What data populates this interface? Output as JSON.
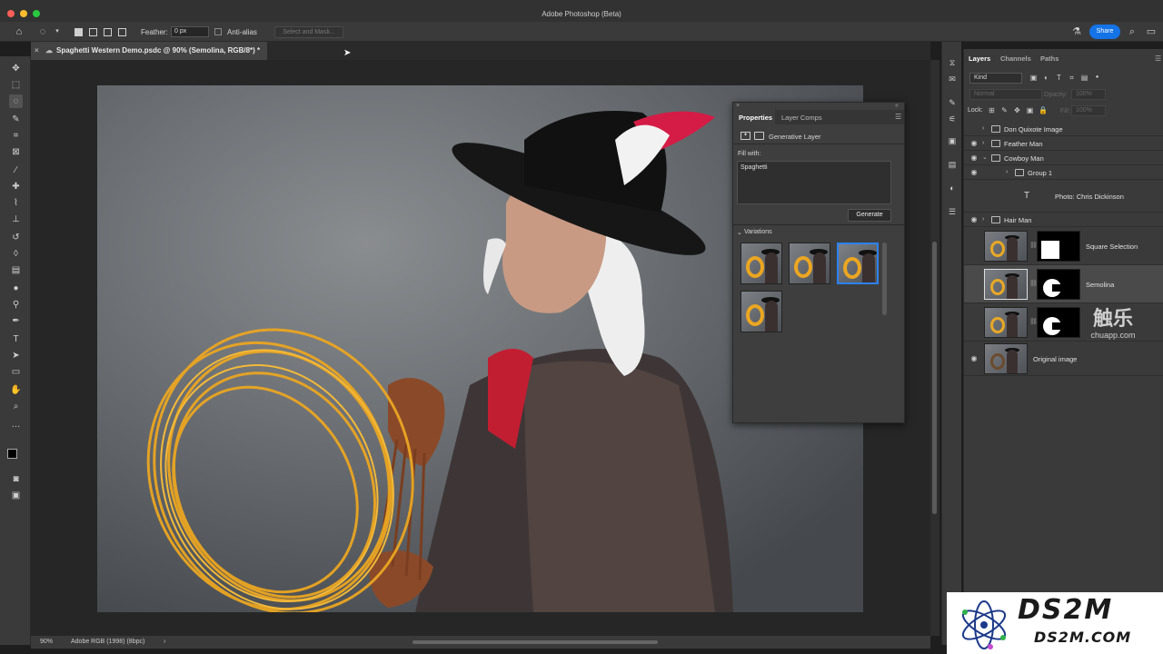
{
  "window": {
    "title": "Adobe Photoshop (Beta)"
  },
  "options_bar": {
    "feather_label": "Feather:",
    "feather_value": "0 px",
    "anti_alias_label": "Anti-alias",
    "select_mask_label": "Select and Mask...",
    "share_label": "Share"
  },
  "document": {
    "tab_title": "Spaghetti Western Demo.psdc @ 90% (Semolina, RGB/8*) *"
  },
  "status_bar": {
    "zoom": "90%",
    "color_profile": "Adobe RGB (1998) (8bpc)"
  },
  "properties": {
    "tab_properties": "Properties",
    "tab_layer_comps": "Layer Comps",
    "header": "Generative Layer",
    "fill_with_label": "Fill with:",
    "prompt": "Spaghetti",
    "generate_label": "Generate",
    "variations_label": "Variations",
    "variation_count": 4,
    "selected_variation": 3
  },
  "layers_panel": {
    "tabs": [
      "Layers",
      "Channels",
      "Paths"
    ],
    "kind_label": "Kind",
    "blend_mode": "Normal",
    "opacity_label": "Opacity:",
    "opacity_value": "100%",
    "lock_label": "Lock:",
    "fill_label": "Fill:",
    "fill_value": "100%",
    "layers": [
      {
        "name": "Don Quixote Image",
        "visible": false
      },
      {
        "name": "Feather Man",
        "visible": true
      },
      {
        "name": "Cowboy Man",
        "visible": true
      },
      {
        "name": "Group 1",
        "visible": true
      },
      {
        "name": "Photo: Chris Dickinson",
        "visible": false
      },
      {
        "name": "Hair Man",
        "visible": true
      },
      {
        "name": "Square Selection",
        "visible": false
      },
      {
        "name": "Semolina",
        "visible": false,
        "selected": true
      },
      {
        "name": "",
        "visible": false
      },
      {
        "name": "Original image",
        "visible": true
      }
    ]
  },
  "watermarks": {
    "chuapp_cn": "触乐",
    "chuapp_url": "chuapp.com",
    "ds2m_title": "DS2M",
    "ds2m_url": "DS2M.COM"
  },
  "colors": {
    "accent": "#1473e6",
    "selection": "#2b82f6",
    "spaghetti": "#e9a826"
  }
}
